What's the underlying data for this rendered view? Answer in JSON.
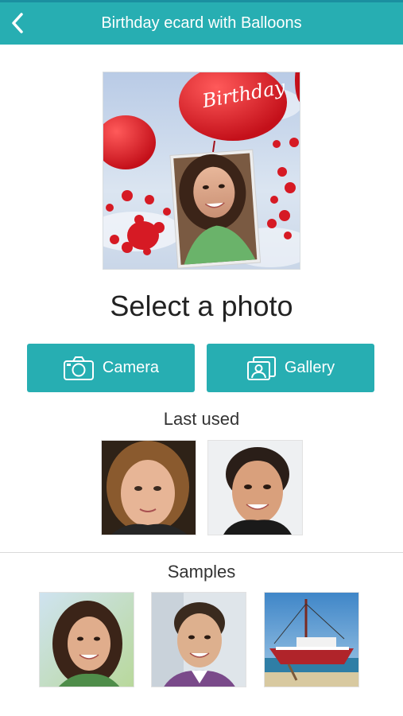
{
  "header": {
    "title": "Birthday ecard with Balloons",
    "background_color": "#27aeb2",
    "back_icon": "chevron-left-icon"
  },
  "preview": {
    "balloon_text": "Birthday"
  },
  "main": {
    "title": "Select a photo",
    "camera_label": "Camera",
    "gallery_label": "Gallery",
    "camera_icon": "camera-icon",
    "gallery_icon": "gallery-icon"
  },
  "last_used": {
    "label": "Last used"
  },
  "samples": {
    "label": "Samples"
  }
}
